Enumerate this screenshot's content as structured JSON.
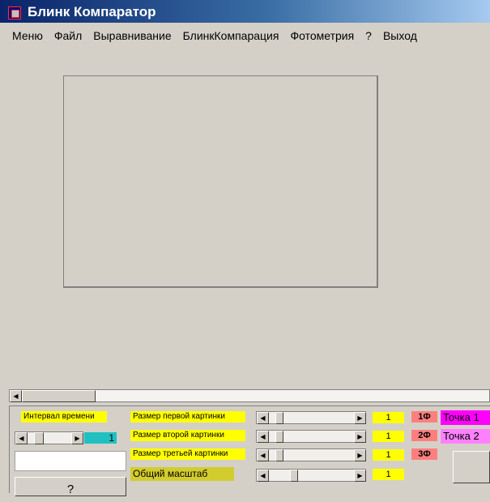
{
  "window": {
    "title": "Блинк Компаратор"
  },
  "menu": [
    "Меню",
    "Файл",
    "Выравнивание",
    "БлинкКомпарация",
    "Фотометрия",
    "?",
    "Выход"
  ],
  "controls": {
    "interval_label": "Интервал времени",
    "interval_value": "1",
    "first_size_label": "Размер первой картинки",
    "first_size_value": "1",
    "second_size_label": "Размер второй картинки",
    "second_size_value": "1",
    "third_size_label": "Размер третьей картинки",
    "third_size_value": "1",
    "overall_scale_label": "Общий масштаб",
    "overall_scale_value": "1",
    "photo1_label": "1Ф",
    "photo2_label": "2Ф",
    "photo3_label": "3Ф",
    "point1_label": "Точка 1",
    "point2_label": "Точка 2",
    "help_button": "?"
  },
  "icons": {
    "app": "app-icon",
    "scroll_left": "arrow-left-icon",
    "scroll_right": "arrow-right-icon"
  },
  "colors": {
    "titlebar": "#0a246a",
    "label_yellow": "#ffff00",
    "label_olive": "#d2cc2e",
    "value_cyan": "#20c0c0",
    "photo_pink": "#ff7f7f",
    "point1_magenta": "#ff00ff",
    "point2_lilac": "#ff80ff"
  }
}
